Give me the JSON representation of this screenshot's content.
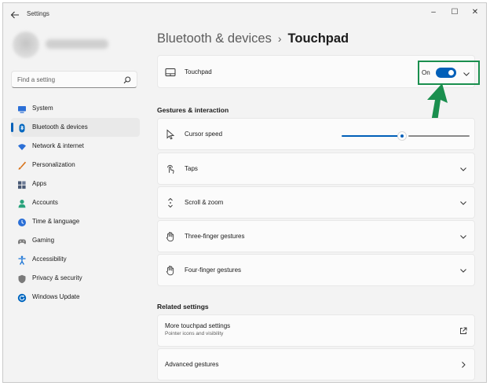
{
  "window": {
    "title": "Settings",
    "controls": [
      "–",
      "☐",
      "✕"
    ]
  },
  "search": {
    "placeholder": "Find a setting"
  },
  "sidebar": {
    "items": [
      {
        "label": "System",
        "icon": "monitor-icon",
        "color": "#2b6fd6"
      },
      {
        "label": "Bluetooth & devices",
        "icon": "bluetooth-icon",
        "color": "#0067c0",
        "selected": true
      },
      {
        "label": "Network & internet",
        "icon": "wifi-icon",
        "color": "#2b6fd6"
      },
      {
        "label": "Personalization",
        "icon": "brush-icon",
        "color": "#d8741c"
      },
      {
        "label": "Apps",
        "icon": "apps-icon",
        "color": "#4a5a75"
      },
      {
        "label": "Accounts",
        "icon": "person-icon",
        "color": "#2aa37c"
      },
      {
        "label": "Time & language",
        "icon": "globe-clock-icon",
        "color": "#2b6fd6"
      },
      {
        "label": "Gaming",
        "icon": "gamepad-icon",
        "color": "#6b6b6b"
      },
      {
        "label": "Accessibility",
        "icon": "accessibility-icon",
        "color": "#1a74d6"
      },
      {
        "label": "Privacy & security",
        "icon": "shield-icon",
        "color": "#6b6b6b"
      },
      {
        "label": "Windows Update",
        "icon": "update-icon",
        "color": "#0067c0"
      }
    ]
  },
  "breadcrumb": {
    "parent": "Bluetooth & devices",
    "separator": "›",
    "current": "Touchpad"
  },
  "touchpad": {
    "label": "Touchpad",
    "state_text": "On",
    "enabled": true
  },
  "sections": {
    "gestures": "Gestures & interaction",
    "related": "Related settings"
  },
  "gestures": {
    "cursor_speed": {
      "label": "Cursor speed",
      "level": 0.47
    },
    "items": [
      {
        "label": "Taps",
        "icon": "tap-icon"
      },
      {
        "label": "Scroll & zoom",
        "icon": "scroll-icon"
      },
      {
        "label": "Three-finger gestures",
        "icon": "hand-icon"
      },
      {
        "label": "Four-finger gestures",
        "icon": "hand-icon"
      }
    ]
  },
  "related": {
    "more": {
      "title": "More touchpad settings",
      "subtitle": "Pointer icons and visibility"
    },
    "advanced": {
      "title": "Advanced gestures"
    }
  },
  "colors": {
    "accent": "#005fb8",
    "highlight": "#1a8f4e"
  }
}
